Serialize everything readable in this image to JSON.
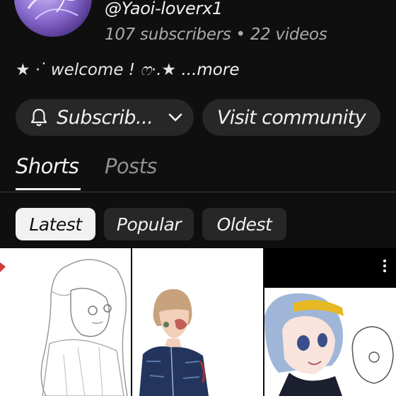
{
  "channel": {
    "handle": "@Yaoi-loverx1",
    "stats": "107 subscribers • 22 videos",
    "bio": "★ ⋅ ̇ welcome ! ෆ⋅.★",
    "more_label": "...more"
  },
  "actions": {
    "subscribe_label": "Subscrib...",
    "visit_label": "Visit community"
  },
  "tabs": [
    {
      "label": "Shorts",
      "active": true
    },
    {
      "label": "Posts",
      "active": false
    }
  ],
  "filters": [
    {
      "label": "Latest",
      "selected": true
    },
    {
      "label": "Popular",
      "selected": false
    },
    {
      "label": "Oldest",
      "selected": false
    }
  ],
  "icons": {
    "subscribe": "bell-icon",
    "dropdown": "chevron-down-icon",
    "menu": "more-vertical-icon"
  },
  "colors": {
    "background": "#0f0f0f",
    "button": "#272727",
    "selected_chip": "#f1f1f1",
    "muted_text": "#aaaaaa"
  }
}
